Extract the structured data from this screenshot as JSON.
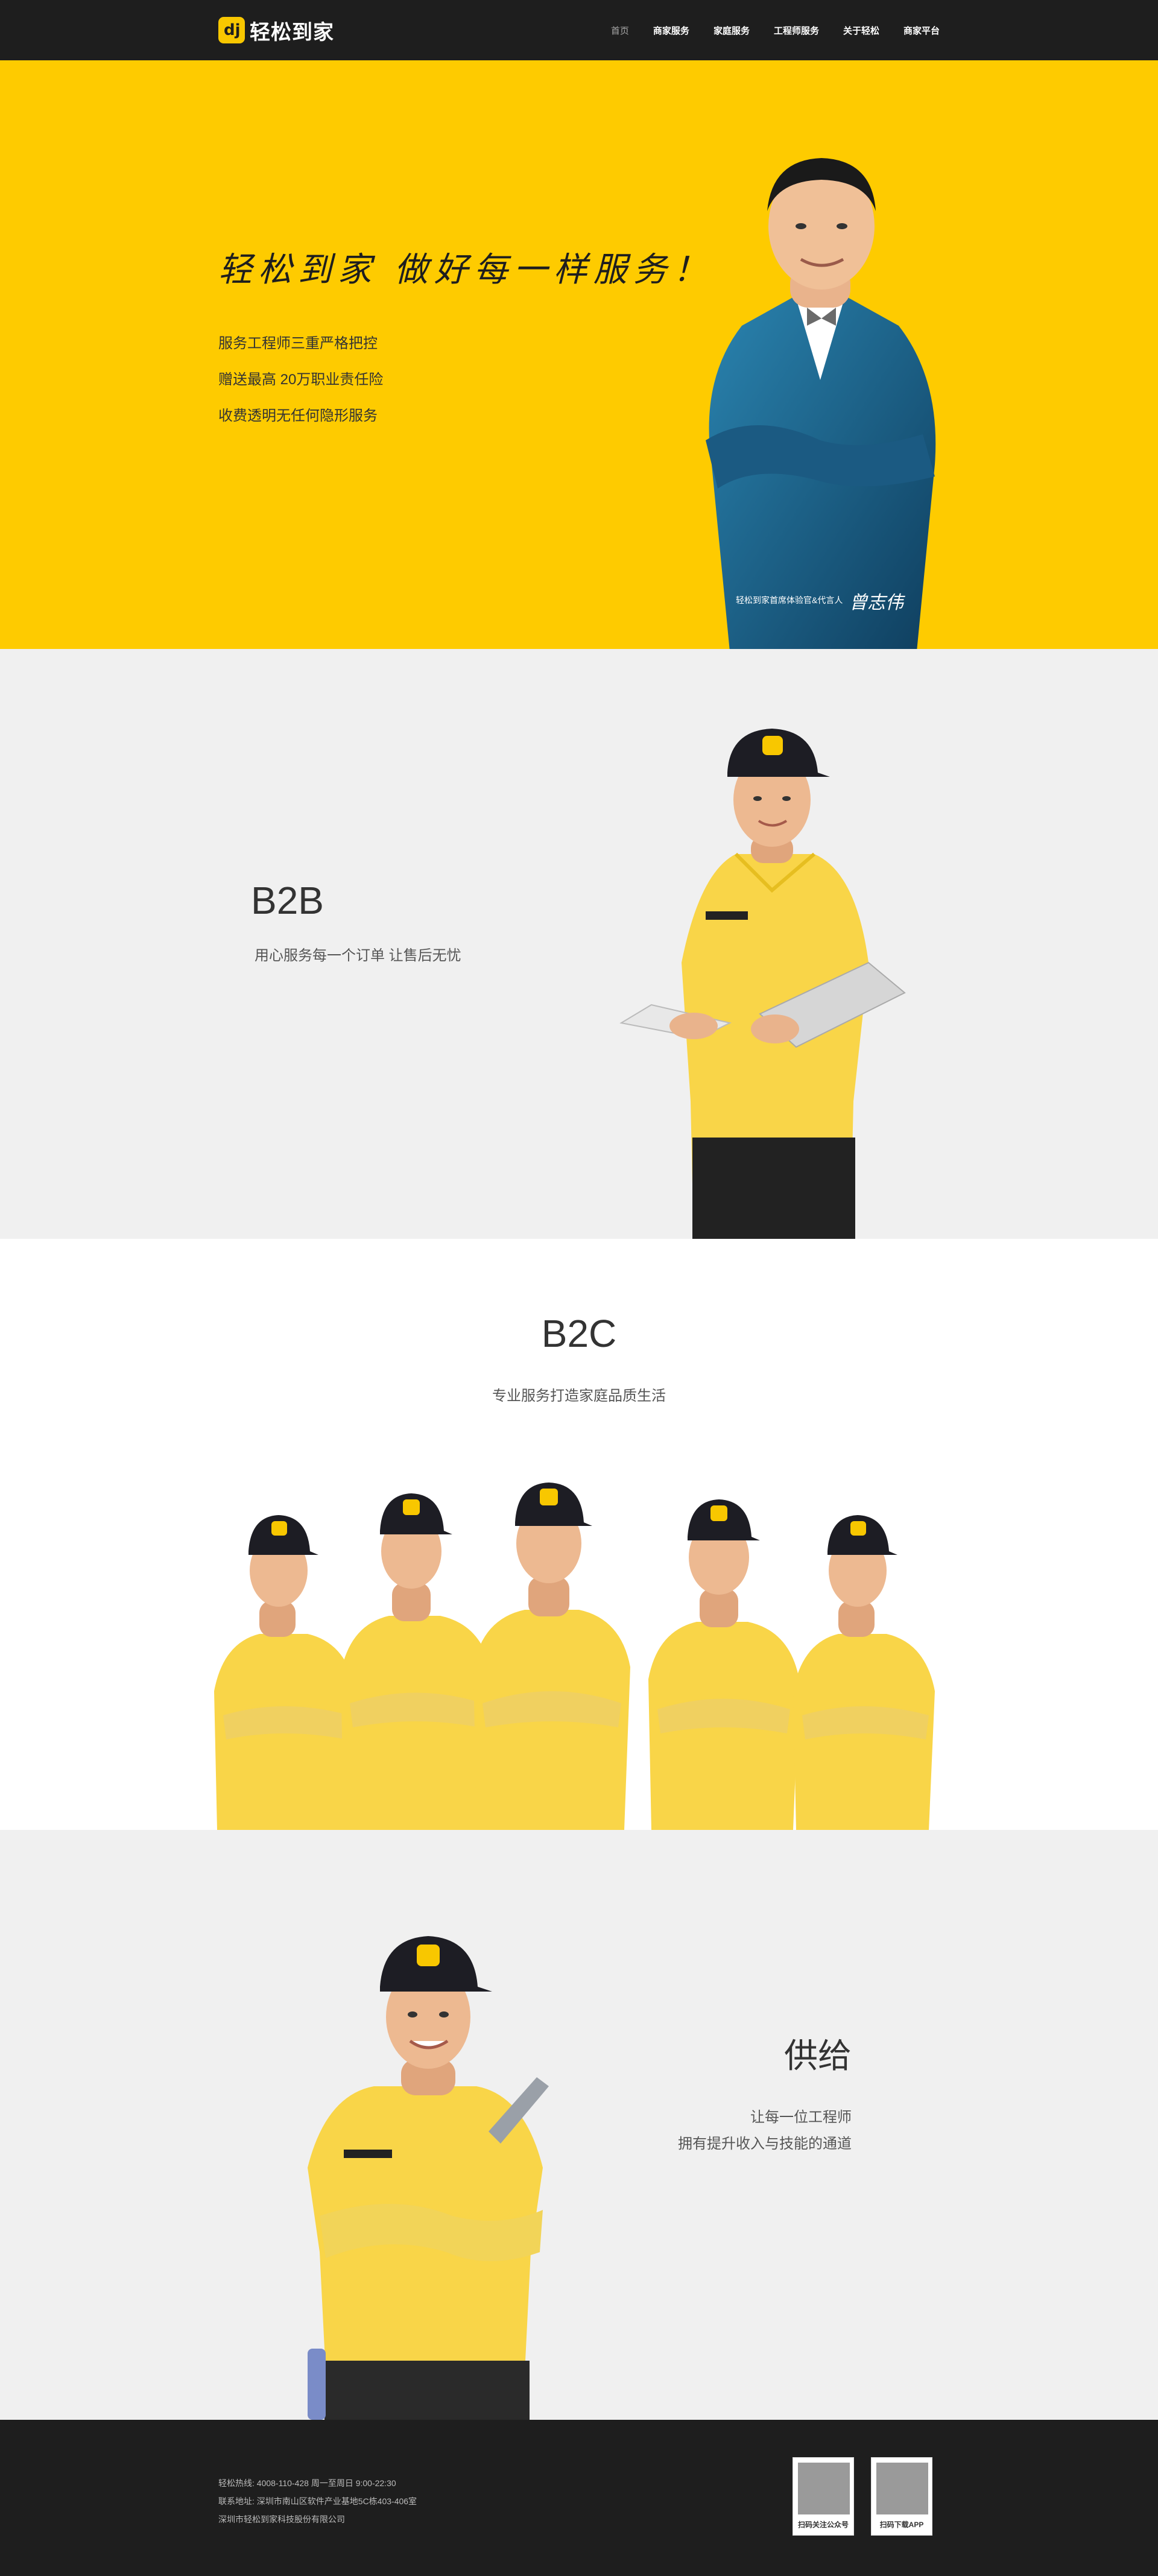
{
  "nav": {
    "logo_mark": "dj",
    "logo_text": "轻松到家",
    "items": [
      "首页",
      "商家服务",
      "家庭服务",
      "工程师服务",
      "关于轻松",
      "商家平台"
    ]
  },
  "hero": {
    "title": "轻松到家  做好每一样服务！",
    "points": [
      "服务工程师三重严格把控",
      "赠送最高 20万职业责任险",
      "收费透明无任何隐形服务"
    ],
    "caption": "轻松到家首席体验官&代言人",
    "signature": "曾志伟"
  },
  "b2b": {
    "title": "B2B",
    "subtitle": "用心服务每一个订单 让售后无忧"
  },
  "b2c": {
    "title": "B2C",
    "subtitle": "专业服务打造家庭品质生活"
  },
  "supply": {
    "title": "供给",
    "line1": "让每一位工程师",
    "line2": "拥有提升收入与技能的通道"
  },
  "footer": {
    "hotline": "轻松热线: 4008-110-428 周一至周日 9:00-22:30",
    "address": "联系地址: 深圳市南山区软件产业基地5C栋403-406室",
    "company": "深圳市轻松到家科技股份有限公司",
    "qr1_label": "扫码关注公众号",
    "qr2_label": "扫码下载APP"
  },
  "colors": {
    "brand_yellow": "#fecb00",
    "nav_dark": "#1e1e1e",
    "section_gray": "#f0f0f0"
  }
}
